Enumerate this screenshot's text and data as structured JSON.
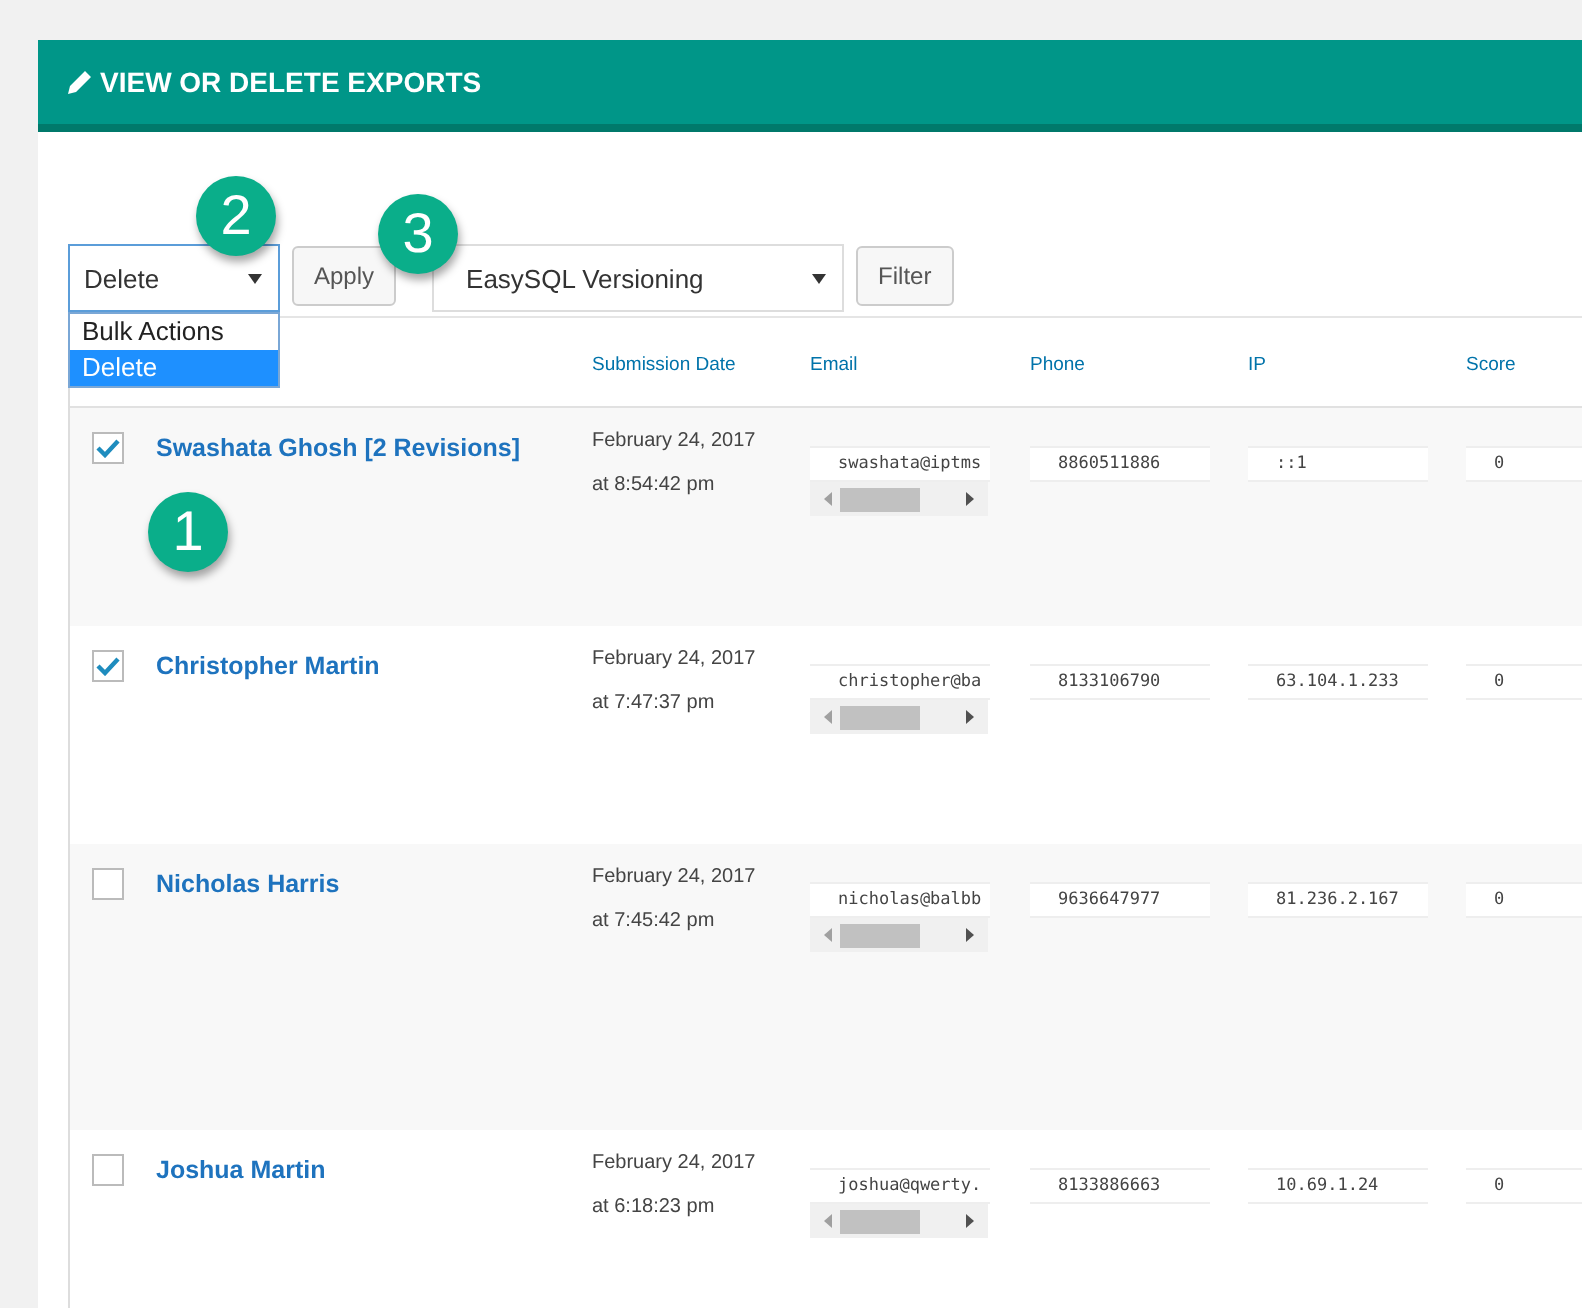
{
  "panel": {
    "title": "VIEW OR DELETE EXPORTS"
  },
  "bulk_action": {
    "value": "Delete",
    "open": true,
    "options": [
      {
        "label": "Bulk Actions",
        "selected": false
      },
      {
        "label": "Delete",
        "selected": true
      }
    ]
  },
  "apply_button": "Apply",
  "form_filter": {
    "value": "EasySQL Versioning"
  },
  "filter_button": "Filter",
  "table": {
    "columns": [
      "Submission Date",
      "Email",
      "Phone",
      "IP",
      "Score"
    ],
    "rows": [
      {
        "checked": true,
        "name": "Swashata Ghosh [2 Revisions]",
        "date": "February 24, 2017",
        "time": "at 8:54:42 pm",
        "email": "swashata@iptms",
        "phone": "8860511886",
        "ip": "::1",
        "score": "0"
      },
      {
        "checked": true,
        "name": "Christopher Martin",
        "date": "February 24, 2017",
        "time": "at 7:47:37 pm",
        "email": "christopher@ba",
        "phone": "8133106790",
        "ip": "63.104.1.233",
        "score": "0"
      },
      {
        "checked": false,
        "name": "Nicholas Harris",
        "date": "February 24, 2017",
        "time": "at 7:45:42 pm",
        "email": "nicholas@balbb",
        "phone": "9636647977",
        "ip": "81.236.2.167",
        "score": "0"
      },
      {
        "checked": false,
        "name": "Joshua Martin",
        "date": "February 24, 2017",
        "time": "at 6:18:23 pm",
        "email": "joshua@qwerty.",
        "phone": "8133886663",
        "ip": "10.69.1.24",
        "score": "0"
      }
    ]
  },
  "callouts": [
    {
      "label": "1"
    },
    {
      "label": "2"
    },
    {
      "label": "3"
    }
  ]
}
